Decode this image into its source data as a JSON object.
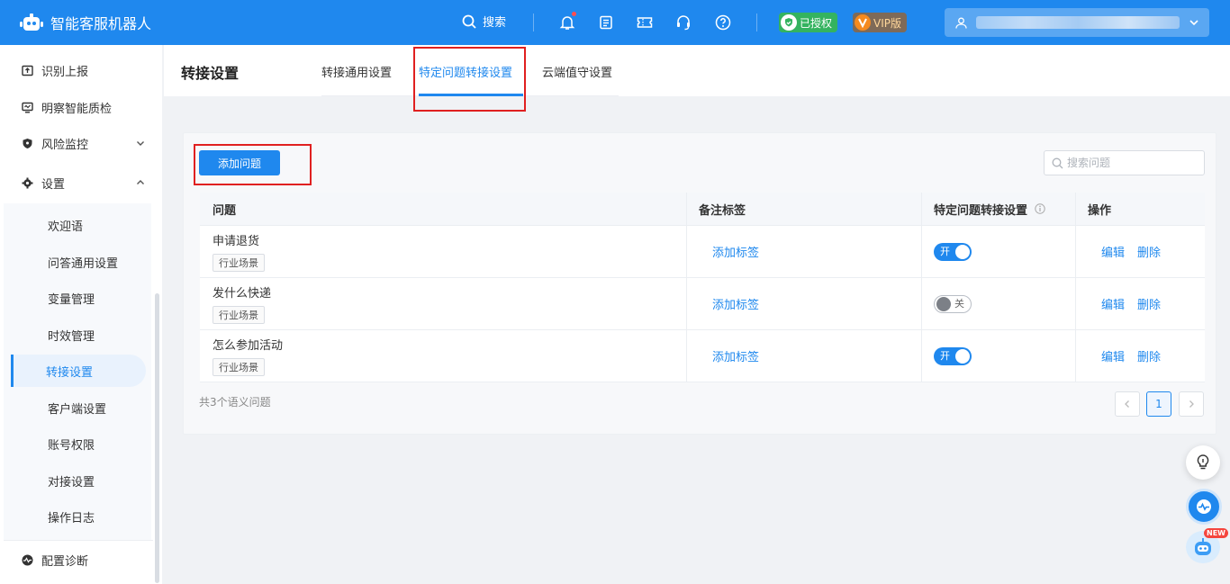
{
  "app": {
    "title": "智能客服机器人"
  },
  "topbar": {
    "search_label": "搜索",
    "badge_auth": "已授权",
    "badge_vip": "VIP版"
  },
  "sidebar": {
    "items": [
      {
        "label": "识别上报",
        "icon": "report-icon"
      },
      {
        "label": "明察智能质检",
        "icon": "quality-check-icon"
      },
      {
        "label": "风险监控",
        "icon": "shield-icon"
      },
      {
        "label": "设置",
        "icon": "gear-icon"
      },
      {
        "label": "配置诊断",
        "icon": "diagnosis-icon"
      }
    ],
    "sub_items": [
      "欢迎语",
      "问答通用设置",
      "变量管理",
      "时效管理",
      "转接设置",
      "客户端设置",
      "账号权限",
      "对接设置",
      "操作日志"
    ],
    "active_sub": "转接设置"
  },
  "page": {
    "title": "转接设置",
    "tabs": [
      "转接通用设置",
      "特定问题转接设置",
      "云端值守设置"
    ],
    "active_tab": "特定问题转接设置"
  },
  "toolbar": {
    "add_label": "添加问题",
    "search_placeholder": "搜索问题"
  },
  "table": {
    "headers": [
      "问题",
      "备注标签",
      "特定问题转接设置",
      "操作"
    ],
    "rows": [
      {
        "question": "申请退货",
        "tag": "行业场景",
        "note": "添加标签",
        "switch_text": "开",
        "switch_on": true,
        "edit": "编辑",
        "delete": "删除"
      },
      {
        "question": "发什么快递",
        "tag": "行业场景",
        "note": "添加标签",
        "switch_text": "关",
        "switch_on": false,
        "edit": "编辑",
        "delete": "删除"
      },
      {
        "question": "怎么参加活动",
        "tag": "行业场景",
        "note": "添加标签",
        "switch_text": "开",
        "switch_on": true,
        "edit": "编辑",
        "delete": "删除"
      }
    ]
  },
  "footer": {
    "total_text": "共3个语义问题",
    "current_page": "1"
  },
  "floating": {
    "new_badge": "NEW"
  },
  "colors": {
    "primary": "#1f88ee",
    "highlight_border": "#e02020",
    "auth_green": "#34b35f"
  }
}
